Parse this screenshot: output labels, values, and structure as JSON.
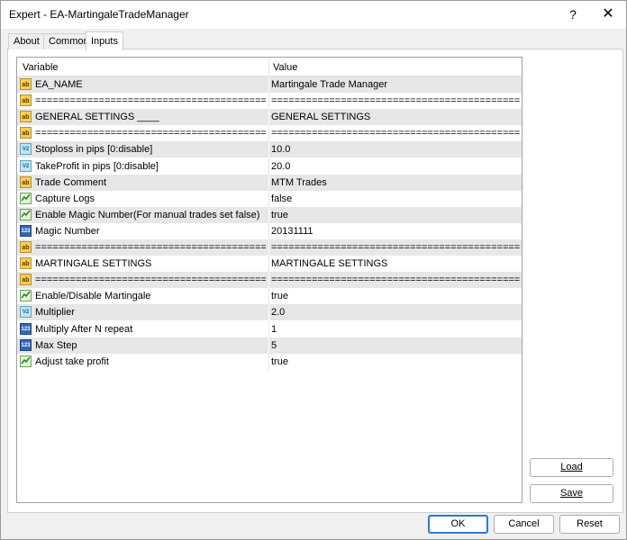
{
  "window": {
    "title": "Expert - EA-MartingaleTradeManager",
    "help": "?",
    "close": "✕"
  },
  "tabs": [
    "About",
    "Common",
    "Inputs"
  ],
  "active_tab": "Inputs",
  "grid": {
    "columns": [
      "Variable",
      "Value"
    ],
    "rows": [
      {
        "icon": "ab",
        "variable": "EA_NAME",
        "value": "Martingale Trade Manager"
      },
      {
        "icon": "ab",
        "variable": "==================================================",
        "value": "====================================================..."
      },
      {
        "icon": "ab",
        "variable": "GENERAL SETTINGS ____",
        "value": "GENERAL SETTINGS"
      },
      {
        "icon": "ab",
        "variable": "==================================================",
        "value": "====================================================..."
      },
      {
        "icon": "dbl",
        "variable": "Stoploss in pips [0:disable]",
        "value": "10.0"
      },
      {
        "icon": "dbl",
        "variable": "TakeProfit in pips [0:disable]",
        "value": "20.0"
      },
      {
        "icon": "ab",
        "variable": "Trade Comment",
        "value": "MTM Trades"
      },
      {
        "icon": "bool",
        "variable": "Capture Logs",
        "value": "false"
      },
      {
        "icon": "bool",
        "variable": "Enable Magic Number(For manual trades set false)",
        "value": "true"
      },
      {
        "icon": "int",
        "variable": "Magic Number",
        "value": "20131111"
      },
      {
        "icon": "ab",
        "variable": "==================================================",
        "value": "====================================================..."
      },
      {
        "icon": "ab",
        "variable": "MARTINGALE SETTINGS",
        "value": "MARTINGALE SETTINGS"
      },
      {
        "icon": "ab",
        "variable": "==================================================",
        "value": "====================================================..."
      },
      {
        "icon": "bool",
        "variable": "Enable/Disable Martingale",
        "value": "true"
      },
      {
        "icon": "dbl",
        "variable": "Multiplier",
        "value": "2.0"
      },
      {
        "icon": "int",
        "variable": "Multiply After N repeat",
        "value": "1"
      },
      {
        "icon": "int",
        "variable": "Max Step",
        "value": "5"
      },
      {
        "icon": "bool",
        "variable": "Adjust take profit",
        "value": "true"
      }
    ]
  },
  "icon_text": {
    "ab": "ab",
    "dbl": "V2",
    "int": "123",
    "bool": ""
  },
  "buttons": {
    "load": "Load",
    "save": "Save",
    "ok": "OK",
    "cancel": "Cancel",
    "reset": "Reset"
  }
}
